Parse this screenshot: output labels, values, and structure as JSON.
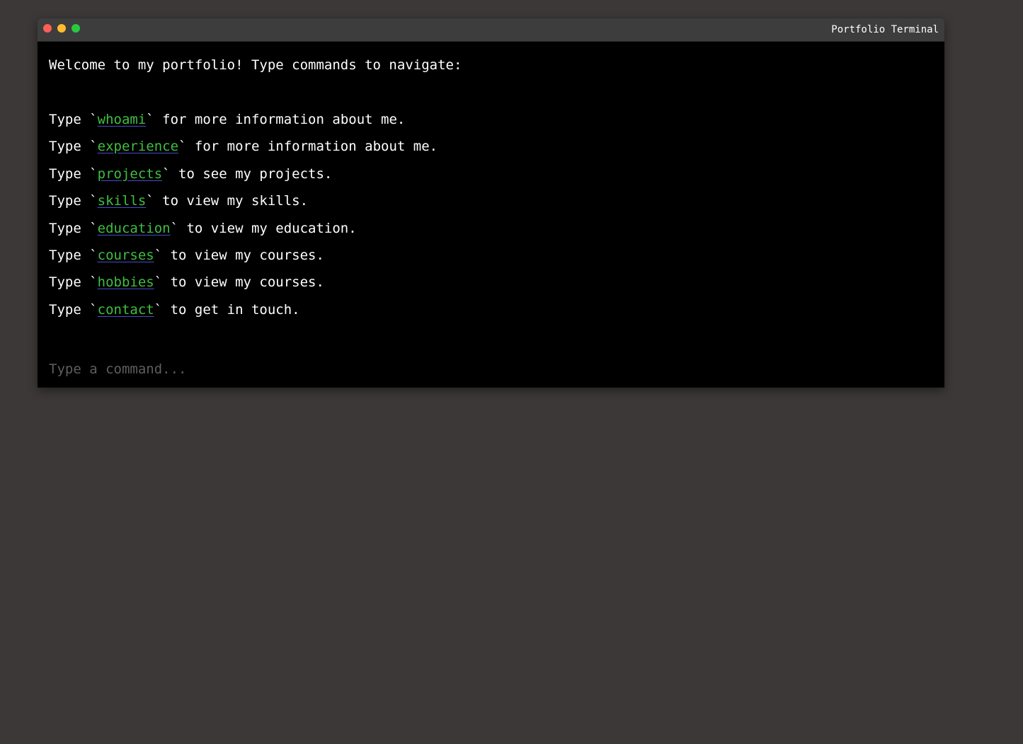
{
  "window": {
    "title": "Portfolio Terminal"
  },
  "terminal": {
    "welcome": "Welcome to my portfolio! Type commands to navigate:",
    "commands": [
      {
        "prefix": "Type `",
        "command": "whoami",
        "suffix": "` for more information about me."
      },
      {
        "prefix": "Type `",
        "command": "experience",
        "suffix": "` for more information about me."
      },
      {
        "prefix": "Type `",
        "command": "projects",
        "suffix": "` to see my projects."
      },
      {
        "prefix": "Type `",
        "command": "skills",
        "suffix": "` to view my skills."
      },
      {
        "prefix": "Type `",
        "command": "education",
        "suffix": "` to view my education."
      },
      {
        "prefix": "Type `",
        "command": "courses",
        "suffix": "` to view my courses."
      },
      {
        "prefix": "Type `",
        "command": "hobbies",
        "suffix": "` to view my courses."
      },
      {
        "prefix": "Type `",
        "command": "contact",
        "suffix": "` to get in touch."
      }
    ],
    "input": {
      "value": "",
      "placeholder": "Type a command..."
    }
  },
  "colors": {
    "page_background": "#3c3837",
    "terminal_background": "#000000",
    "title_bar": "#3d3d3d",
    "command_link": "#3fbf3f",
    "text": "#ffffff"
  }
}
